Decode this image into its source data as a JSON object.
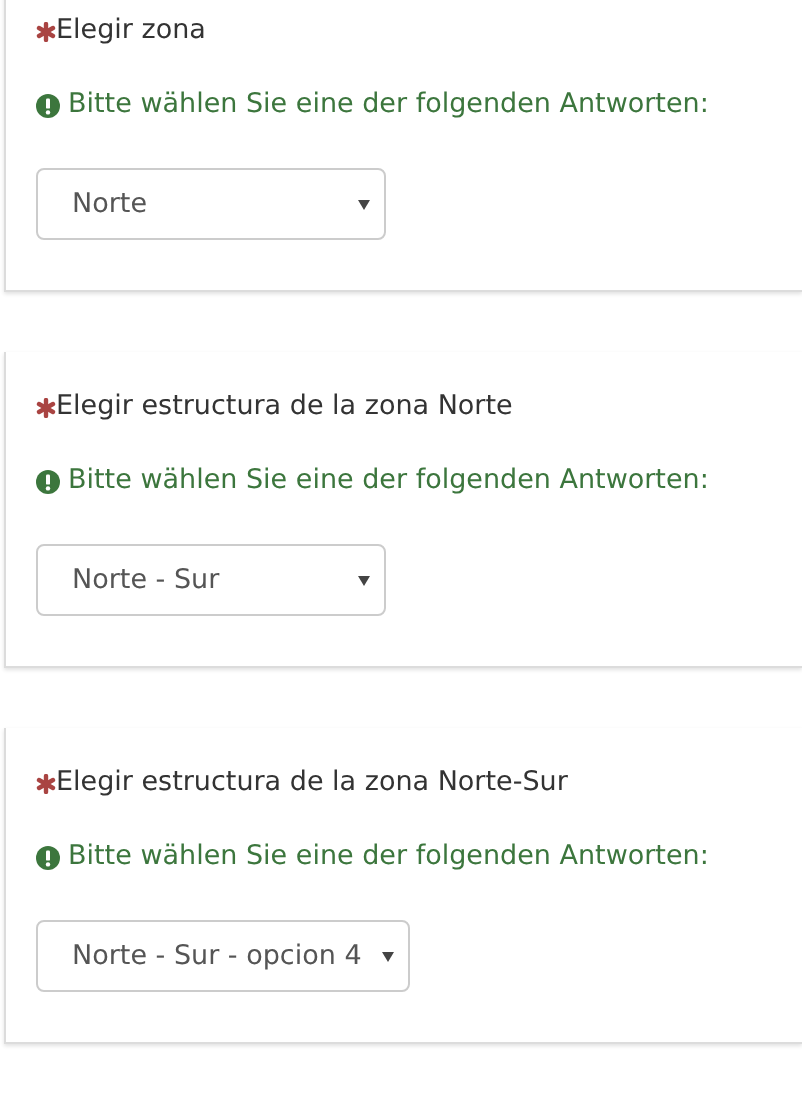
{
  "questions": [
    {
      "label": "Elegir zona",
      "required": true,
      "hint": "Bitte wählen Sie eine der folgenden Antworten:",
      "select": {
        "value": "Norte"
      }
    },
    {
      "label": "Elegir estructura de la zona Norte",
      "required": true,
      "hint": "Bitte wählen Sie eine der folgenden Antworten:",
      "select": {
        "value": "Norte - Sur"
      }
    },
    {
      "label": "Elegir estructura de la zona Norte-Sur",
      "required": true,
      "hint": "Bitte wählen Sie eine der folgenden Antworten:",
      "select": {
        "value": "Norte - Sur - opcion 4"
      }
    }
  ]
}
